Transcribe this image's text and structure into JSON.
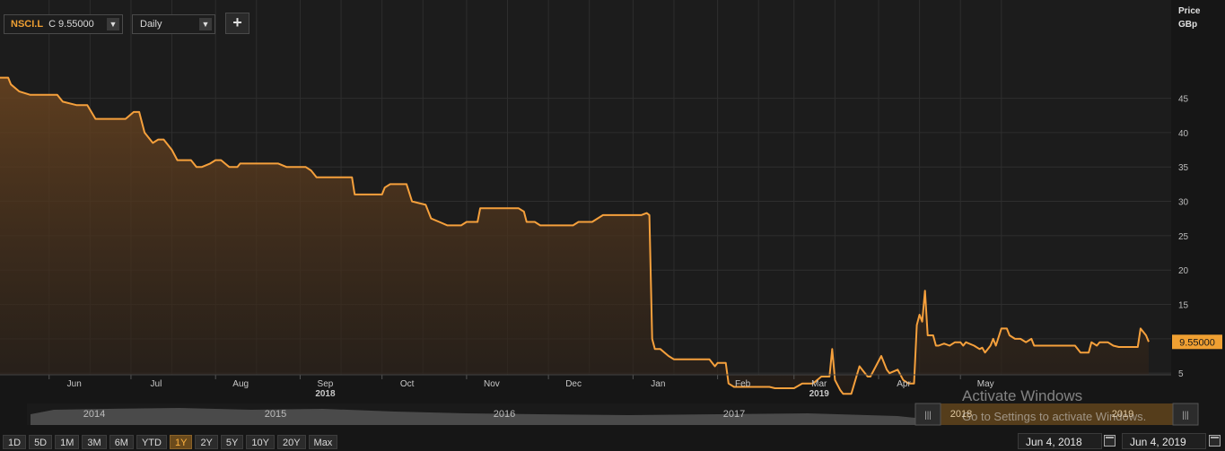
{
  "toolbar": {
    "ticker": "NSCI.L",
    "close_prefix": "C",
    "close_value": "9.55000",
    "interval": "Daily",
    "add_label": "+"
  },
  "axis": {
    "title_line1": "Price",
    "title_line2": "GBp"
  },
  "chart_data": {
    "type": "area",
    "title": "",
    "xlabel": "",
    "ylabel": "Price GBp",
    "ylim": [
      0,
      50
    ],
    "yticks": [
      5,
      10,
      15,
      20,
      25,
      30,
      35,
      40,
      45
    ],
    "ytick_labels": [
      "5",
      "10",
      "15",
      "20",
      "25",
      "30",
      "35",
      "40",
      "45"
    ],
    "last_value": 9.55,
    "last_value_label": "9.55000",
    "grid": true,
    "xlim": [
      "2018-05-14",
      "2019-06-05"
    ],
    "x_month_ticks": [
      {
        "date": "2018-06-01",
        "label": "Jun",
        "year": ""
      },
      {
        "date": "2018-07-01",
        "label": "Jul",
        "year": ""
      },
      {
        "date": "2018-08-01",
        "label": "Aug",
        "year": ""
      },
      {
        "date": "2018-09-01",
        "label": "Sep",
        "year": "2018"
      },
      {
        "date": "2018-10-01",
        "label": "Oct",
        "year": ""
      },
      {
        "date": "2018-11-01",
        "label": "Nov",
        "year": ""
      },
      {
        "date": "2018-12-01",
        "label": "Dec",
        "year": ""
      },
      {
        "date": "2019-01-01",
        "label": "Jan",
        "year": ""
      },
      {
        "date": "2019-02-01",
        "label": "Feb",
        "year": ""
      },
      {
        "date": "2019-03-01",
        "label": "Mar",
        "year": "2019"
      },
      {
        "date": "2019-04-01",
        "label": "Apr",
        "year": ""
      },
      {
        "date": "2019-05-01",
        "label": "May",
        "year": ""
      }
    ],
    "series": [
      {
        "color": "#f5a03c",
        "points": [
          [
            "2018-05-14",
            48.0
          ],
          [
            "2018-05-17",
            48.0
          ],
          [
            "2018-05-18",
            47.0
          ],
          [
            "2018-05-21",
            46.0
          ],
          [
            "2018-05-25",
            45.5
          ],
          [
            "2018-06-04",
            45.5
          ],
          [
            "2018-06-06",
            44.5
          ],
          [
            "2018-06-11",
            44.0
          ],
          [
            "2018-06-15",
            44.0
          ],
          [
            "2018-06-18",
            42.0
          ],
          [
            "2018-06-25",
            42.0
          ],
          [
            "2018-06-29",
            42.0
          ],
          [
            "2018-07-02",
            43.0
          ],
          [
            "2018-07-04",
            43.0
          ],
          [
            "2018-07-06",
            40.0
          ],
          [
            "2018-07-09",
            38.5
          ],
          [
            "2018-07-11",
            39.0
          ],
          [
            "2018-07-13",
            39.0
          ],
          [
            "2018-07-16",
            37.5
          ],
          [
            "2018-07-18",
            36.0
          ],
          [
            "2018-07-23",
            36.0
          ],
          [
            "2018-07-25",
            35.0
          ],
          [
            "2018-07-27",
            35.0
          ],
          [
            "2018-07-30",
            35.5
          ],
          [
            "2018-08-01",
            36.0
          ],
          [
            "2018-08-03",
            36.0
          ],
          [
            "2018-08-06",
            35.0
          ],
          [
            "2018-08-09",
            35.0
          ],
          [
            "2018-08-10",
            35.5
          ],
          [
            "2018-08-24",
            35.5
          ],
          [
            "2018-08-27",
            35.0
          ],
          [
            "2018-09-03",
            35.0
          ],
          [
            "2018-09-05",
            34.5
          ],
          [
            "2018-09-07",
            33.5
          ],
          [
            "2018-09-14",
            33.5
          ],
          [
            "2018-09-20",
            33.5
          ],
          [
            "2018-09-21",
            31.0
          ],
          [
            "2018-09-28",
            31.0
          ],
          [
            "2018-10-01",
            31.0
          ],
          [
            "2018-10-02",
            32.0
          ],
          [
            "2018-10-04",
            32.5
          ],
          [
            "2018-10-10",
            32.5
          ],
          [
            "2018-10-12",
            30.0
          ],
          [
            "2018-10-17",
            29.5
          ],
          [
            "2018-10-19",
            27.5
          ],
          [
            "2018-10-22",
            27.0
          ],
          [
            "2018-10-25",
            26.5
          ],
          [
            "2018-10-30",
            26.5
          ],
          [
            "2018-11-01",
            27.0
          ],
          [
            "2018-11-05",
            27.0
          ],
          [
            "2018-11-06",
            29.0
          ],
          [
            "2018-11-20",
            29.0
          ],
          [
            "2018-11-22",
            28.5
          ],
          [
            "2018-11-23",
            27.0
          ],
          [
            "2018-11-26",
            27.0
          ],
          [
            "2018-11-28",
            26.5
          ],
          [
            "2018-12-05",
            26.5
          ],
          [
            "2018-12-10",
            26.5
          ],
          [
            "2018-12-12",
            27.0
          ],
          [
            "2018-12-17",
            27.0
          ],
          [
            "2018-12-21",
            28.0
          ],
          [
            "2019-01-04",
            28.0
          ],
          [
            "2019-01-06",
            28.3
          ],
          [
            "2019-01-07",
            28.0
          ],
          [
            "2019-01-08",
            10.0
          ],
          [
            "2019-01-09",
            8.5
          ],
          [
            "2019-01-11",
            8.5
          ],
          [
            "2019-01-14",
            7.5
          ],
          [
            "2019-01-16",
            7.0
          ],
          [
            "2019-01-17",
            7.0
          ],
          [
            "2019-01-29",
            7.0
          ],
          [
            "2019-01-31",
            6.0
          ],
          [
            "2019-02-01",
            6.5
          ],
          [
            "2019-02-04",
            6.5
          ],
          [
            "2019-02-05",
            3.5
          ],
          [
            "2019-02-07",
            3.0
          ],
          [
            "2019-02-20",
            3.0
          ],
          [
            "2019-02-22",
            2.8
          ],
          [
            "2019-03-01",
            2.8
          ],
          [
            "2019-03-04",
            3.5
          ],
          [
            "2019-03-08",
            3.5
          ],
          [
            "2019-03-11",
            4.5
          ],
          [
            "2019-03-14",
            4.5
          ],
          [
            "2019-03-15",
            8.5
          ],
          [
            "2019-03-16",
            4.0
          ],
          [
            "2019-03-18",
            2.5
          ],
          [
            "2019-03-19",
            2.0
          ],
          [
            "2019-03-22",
            2.0
          ],
          [
            "2019-03-25",
            6.0
          ],
          [
            "2019-03-27",
            5.0
          ],
          [
            "2019-03-28",
            4.5
          ],
          [
            "2019-03-29",
            4.5
          ],
          [
            "2019-04-02",
            7.5
          ],
          [
            "2019-04-04",
            5.5
          ],
          [
            "2019-04-05",
            5.0
          ],
          [
            "2019-04-08",
            5.5
          ],
          [
            "2019-04-10",
            4.0
          ],
          [
            "2019-04-12",
            3.5
          ],
          [
            "2019-04-14",
            3.5
          ],
          [
            "2019-04-15",
            12.0
          ],
          [
            "2019-04-16",
            13.5
          ],
          [
            "2019-04-17",
            12.5
          ],
          [
            "2019-04-18",
            17.0
          ],
          [
            "2019-04-19",
            10.5
          ],
          [
            "2019-04-21",
            10.5
          ],
          [
            "2019-04-22",
            9.0
          ],
          [
            "2019-04-23",
            9.0
          ],
          [
            "2019-04-25",
            9.3
          ],
          [
            "2019-04-27",
            9.0
          ],
          [
            "2019-04-29",
            9.5
          ],
          [
            "2019-05-01",
            9.5
          ],
          [
            "2019-05-02",
            9.0
          ],
          [
            "2019-05-03",
            9.5
          ],
          [
            "2019-05-06",
            9.0
          ],
          [
            "2019-05-08",
            8.5
          ],
          [
            "2019-05-09",
            8.7
          ],
          [
            "2019-05-10",
            8.0
          ],
          [
            "2019-05-12",
            9.0
          ],
          [
            "2019-05-13",
            10.0
          ],
          [
            "2019-05-14",
            9.0
          ],
          [
            "2019-05-16",
            11.5
          ],
          [
            "2019-05-18",
            11.5
          ],
          [
            "2019-05-19",
            10.5
          ],
          [
            "2019-05-21",
            10.0
          ],
          [
            "2019-05-23",
            10.0
          ],
          [
            "2019-05-25",
            9.5
          ],
          [
            "2019-05-27",
            10.0
          ],
          [
            "2019-05-28",
            9.0
          ],
          [
            "2019-05-30",
            9.0
          ],
          [
            "2019-06-03",
            9.0
          ],
          [
            "2019-06-05",
            9.0
          ],
          [
            "2019-06-06",
            9.0
          ],
          [
            "2019-06-10",
            9.0
          ],
          [
            "2019-06-12",
            9.0
          ],
          [
            "2019-06-14",
            8.0
          ],
          [
            "2019-06-17",
            8.0
          ],
          [
            "2019-06-18",
            9.5
          ],
          [
            "2019-06-20",
            9.0
          ],
          [
            "2019-06-21",
            9.5
          ],
          [
            "2019-06-24",
            9.5
          ],
          [
            "2019-06-26",
            9.0
          ],
          [
            "2019-06-28",
            8.8
          ],
          [
            "2019-07-02",
            8.8
          ],
          [
            "2019-07-05",
            8.8
          ],
          [
            "2019-07-06",
            11.5
          ],
          [
            "2019-07-08",
            10.5
          ],
          [
            "2019-07-09",
            9.55
          ]
        ]
      }
    ]
  },
  "navigator": {
    "years": [
      "2014",
      "2015",
      "2016",
      "2017",
      "2018",
      "2019"
    ],
    "handle_glyph": "|||"
  },
  "range_buttons": [
    "1D",
    "5D",
    "1M",
    "3M",
    "6M",
    "YTD",
    "1Y",
    "2Y",
    "5Y",
    "10Y",
    "20Y",
    "Max"
  ],
  "active_range": "1Y",
  "date_range": {
    "from": "Jun 4, 2018",
    "to": "Jun 4, 2019"
  },
  "watermark": {
    "title": "Activate Windows",
    "subtitle": "Go to Settings to activate Windows."
  },
  "colors": {
    "line": "#f5a03c",
    "accent": "#f0a032",
    "background": "#161616",
    "grid": "#2e2e2e"
  }
}
